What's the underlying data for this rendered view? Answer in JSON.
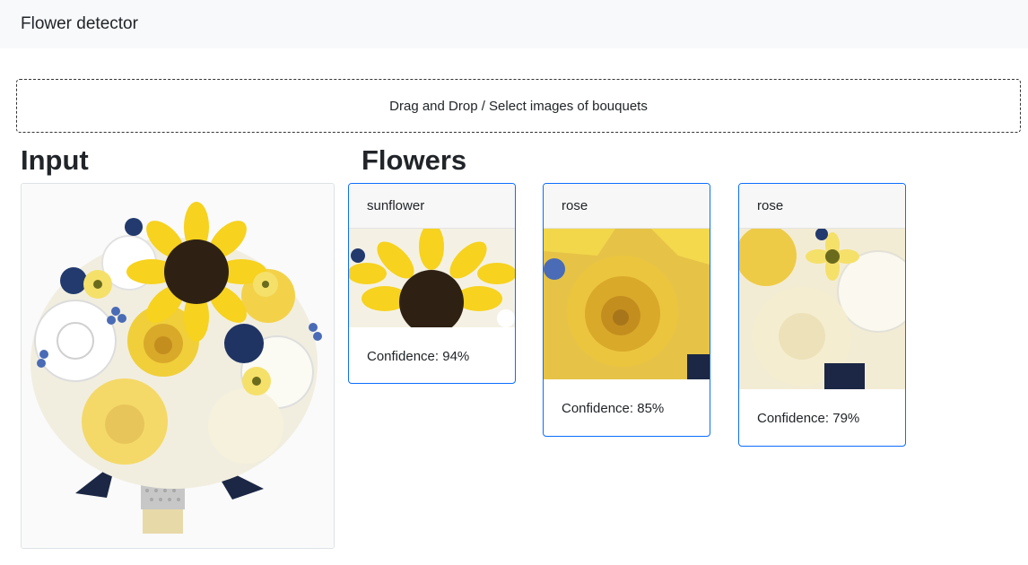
{
  "navbar": {
    "brand": "Flower detector"
  },
  "upload": {
    "label": "Drag and Drop / Select images of bouquets"
  },
  "sections": {
    "input_title": "Input",
    "flowers_title": "Flowers"
  },
  "results": [
    {
      "name": "sunflower",
      "confidence": "Confidence: 94%"
    },
    {
      "name": "rose",
      "confidence": "Confidence: 85%"
    },
    {
      "name": "rose",
      "confidence": "Confidence: 79%"
    }
  ],
  "colors": {
    "navbar_bg": "#f8f9fa",
    "card_border": "#0d6efd",
    "flower_yellow": "#f2d02b",
    "ribbon_navy": "#1c2a4a"
  }
}
